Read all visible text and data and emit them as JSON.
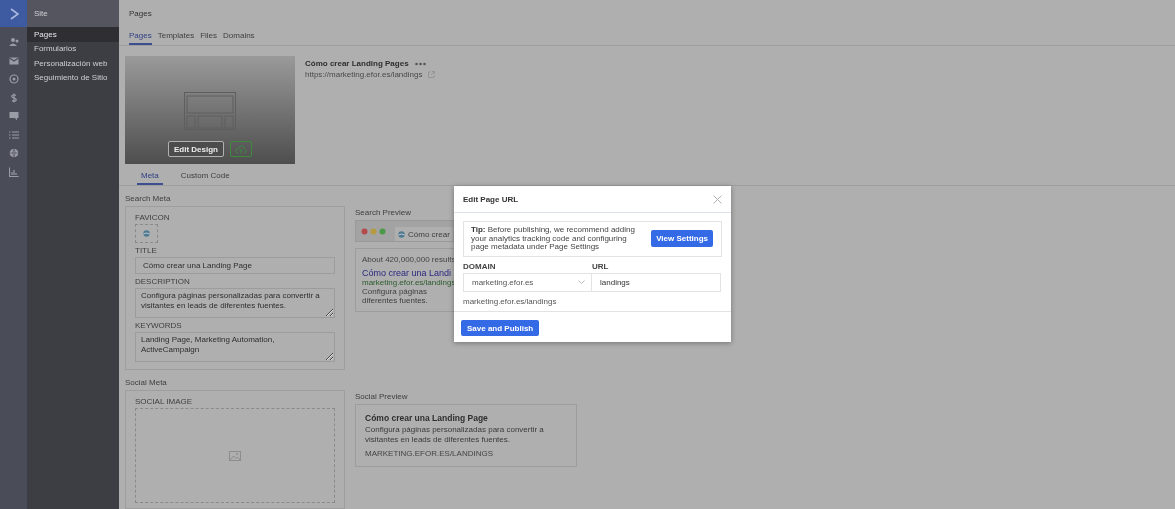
{
  "sidebar": {
    "section": "Site",
    "items": [
      {
        "label": "Pages",
        "selected": true
      },
      {
        "label": "Formularios",
        "selected": false
      },
      {
        "label": "Personalización web",
        "selected": false
      },
      {
        "label": "Seguimiento de Sitio",
        "selected": false
      }
    ]
  },
  "header": {
    "title": "Pages"
  },
  "tabs": [
    {
      "label": "Pages",
      "selected": true
    },
    {
      "label": "Templates",
      "selected": false
    },
    {
      "label": "Files",
      "selected": false
    },
    {
      "label": "Domains",
      "selected": false
    }
  ],
  "page_card": {
    "title": "Cómo crear Landing Pages",
    "url": "https://marketing.efor.es/landings",
    "edit_button": "Edit Design"
  },
  "meta_tabs": [
    {
      "label": "Meta",
      "selected": true
    },
    {
      "label": "Custom Code",
      "selected": false
    }
  ],
  "search_meta": {
    "heading": "Search Meta",
    "favicon_label": "FAVICON",
    "title_label": "TITLE",
    "title_value": "Cómo crear una Landing Page",
    "description_label": "DESCRIPTION",
    "description_value": "Configura páginas personalizadas para convertir a visitantes en leads de diferentes fuentes.",
    "keywords_label": "KEYWORDS",
    "keywords_value": "Landing Page, Marketing Automation, ActiveCampaign"
  },
  "search_preview": {
    "heading": "Search Preview",
    "tab_title": "Cómo crear",
    "results_count": "About 420,000,000 results",
    "result_title": "Cómo crear una Landi",
    "result_url": "marketing.efor.es/landings",
    "result_description": [
      "Configura páginas",
      "diferentes fuentes."
    ]
  },
  "social_meta": {
    "heading": "Social Meta",
    "image_label": "SOCIAL IMAGE"
  },
  "social_preview": {
    "heading": "Social Preview",
    "title": "Cómo crear una Landing Page",
    "description": "Configura páginas personalizadas para convertir a visitantes en leads de diferentes fuentes.",
    "url": "MARKETING.EFOR.ES/LANDINGS"
  },
  "modal": {
    "title": "Edit Page URL",
    "tip": "**Tip:** Before publishing, we recommend adding your analytics tracking code and configuring page metadata under Page Settings",
    "view_settings": "View Settings",
    "domain_label": "DOMAIN",
    "domain_value": "marketing.efor.es",
    "url_label": "URL",
    "url_value": "landings",
    "url_preview": "marketing.efor.es/landings",
    "save_button": "Save and Publish"
  }
}
